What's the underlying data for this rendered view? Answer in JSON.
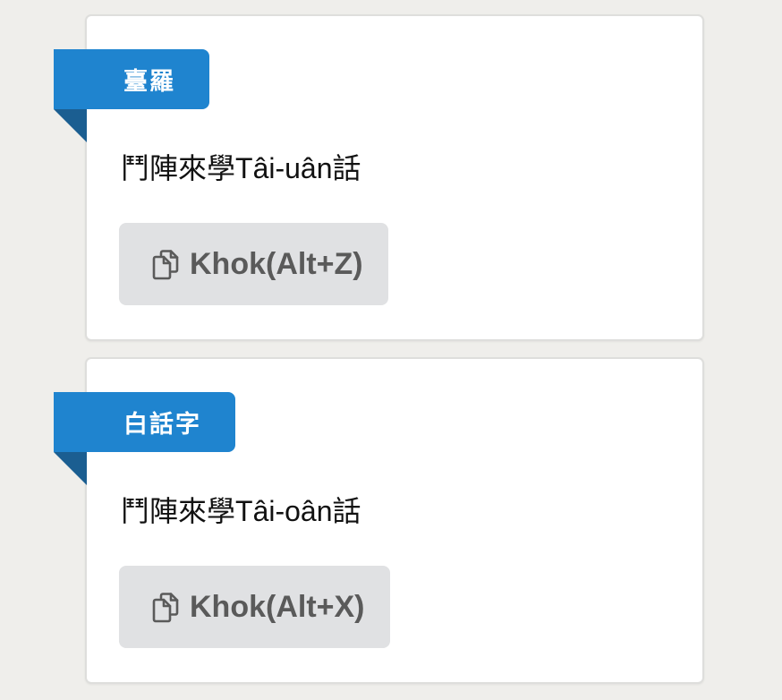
{
  "cards": [
    {
      "tag": "臺羅",
      "text_han_prefix": "鬥陣來學",
      "text_latin": "Tâi-uân",
      "text_han_suffix": "話",
      "copy_button_label": "Khok(Alt+Z)",
      "copy_icon": "copy-icon"
    },
    {
      "tag": "白話字",
      "text_han_prefix": "鬥陣來學",
      "text_latin": "Tâi-oân",
      "text_han_suffix": "話",
      "copy_button_label": "Khok(Alt+X)",
      "copy_icon": "copy-icon"
    }
  ],
  "colors": {
    "background": "#efeeeb",
    "ribbon": "#1f84cf",
    "ribbon_fold": "#1b5e91",
    "button_bg": "#e0e1e3",
    "button_text": "#5a5a5a"
  }
}
